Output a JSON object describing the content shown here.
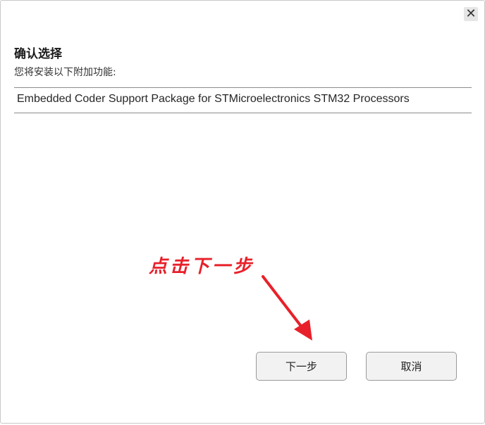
{
  "dialog": {
    "close_glyph": "✕",
    "title": "确认选择",
    "subtitle": "您将安装以下附加功能:",
    "packages": [
      "Embedded Coder Support Package for STMicroelectronics STM32 Processors"
    ],
    "annotation": "点击下一步",
    "buttons": {
      "next_label": "下一步",
      "cancel_label": "取消"
    }
  },
  "colors": {
    "annotation": "#e8202a",
    "button_bg": "#f2f2f2",
    "button_border": "#9a9a9a"
  }
}
